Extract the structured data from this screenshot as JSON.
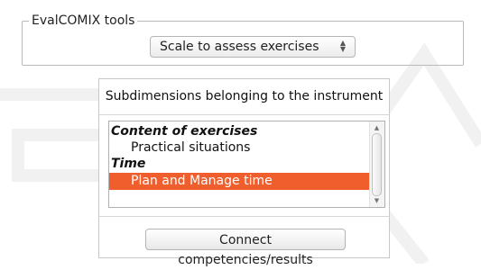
{
  "tools": {
    "legend": "EvalCOMIX tools",
    "select": {
      "value": "Scale to assess exercises"
    }
  },
  "panel": {
    "title": "Subdimensions belonging to the instrument",
    "options": [
      {
        "label": "Content of exercises",
        "kind": "group"
      },
      {
        "label": "Practical situations",
        "kind": "item"
      },
      {
        "label": "Time",
        "kind": "group"
      },
      {
        "label": "Plan and Manage time",
        "kind": "item",
        "selected": true
      }
    ],
    "connect_button": "Connect competencies/results"
  },
  "colors": {
    "selection": "#ef5e2c"
  }
}
